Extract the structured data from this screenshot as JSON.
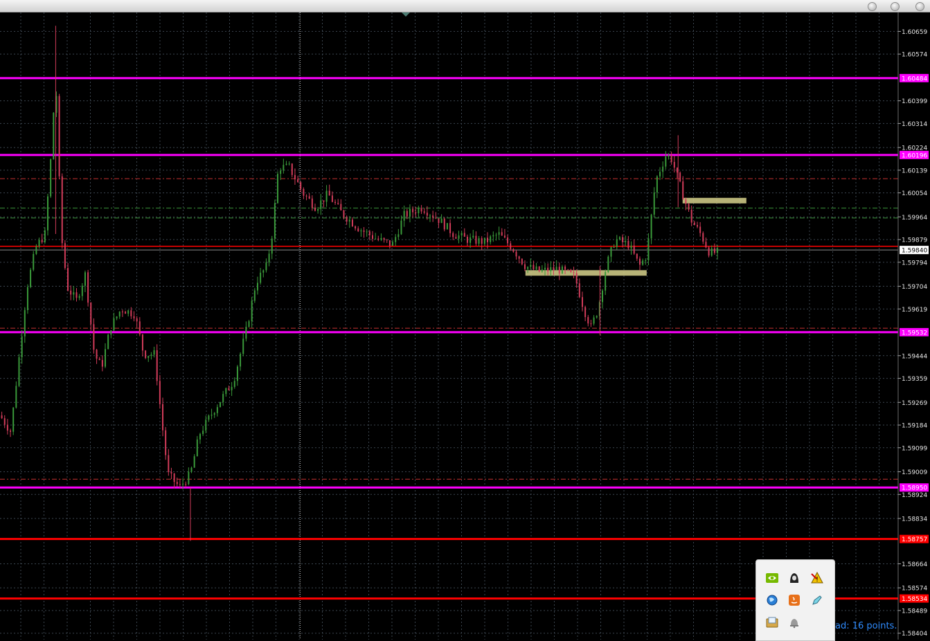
{
  "window": {
    "buttons": [
      "minimize",
      "zoom",
      "close"
    ]
  },
  "chart_data": {
    "type": "candlestick",
    "ylim": [
      1.5838,
      1.6073
    ],
    "grid": true,
    "background": "#000000",
    "colors": {
      "bull": "#3a9a3a",
      "bear": "#d23c5a",
      "grid": "#3c4650",
      "support_resistance": "#ff00ff",
      "strong_level": "#ff0000",
      "dotted_level": "#c83232",
      "green_level": "#3c963c",
      "zone": "#d7d28c"
    },
    "price_axis_ticks": [
      "1.60659",
      "1.60574",
      "1.60399",
      "1.60314",
      "1.60224",
      "1.60139",
      "1.60054",
      "1.59964",
      "1.59879",
      "1.59794",
      "1.59704",
      "1.59619",
      "1.59444",
      "1.59359",
      "1.59269",
      "1.59184",
      "1.59099",
      "1.59009",
      "1.58924",
      "1.58834",
      "1.58664",
      "1.58574",
      "1.58489",
      "1.58404"
    ],
    "price_axis_tick_values": [
      1.60659,
      1.60574,
      1.60399,
      1.60314,
      1.60224,
      1.60139,
      1.60054,
      1.59964,
      1.59879,
      1.59794,
      1.59704,
      1.59619,
      1.59444,
      1.59359,
      1.59269,
      1.59184,
      1.59099,
      1.59009,
      1.58924,
      1.58834,
      1.58664,
      1.58574,
      1.58489,
      1.58404
    ],
    "current_price": {
      "label": "1.59840",
      "value": 1.5984
    },
    "horizontal_levels": [
      {
        "label": "1.60484",
        "value": 1.60484,
        "style": "magenta-solid"
      },
      {
        "label": "1.60196",
        "value": 1.60196,
        "style": "magenta-solid"
      },
      {
        "label": "1.59532",
        "value": 1.59532,
        "style": "magenta-solid"
      },
      {
        "label": "1.58950",
        "value": 1.5895,
        "style": "magenta-solid"
      },
      {
        "label": "1.58757",
        "value": 1.58757,
        "style": "red-solid"
      },
      {
        "label": "1.58534",
        "value": 1.58534,
        "style": "red-solid"
      },
      {
        "label": "",
        "value": 1.59854,
        "style": "red-thin"
      },
      {
        "label": "",
        "value": 1.60107,
        "style": "red-dashdot"
      },
      {
        "label": "",
        "value": 1.59547,
        "style": "red-dashdot"
      },
      {
        "label": "",
        "value": 1.58981,
        "style": "red-dashdot"
      },
      {
        "label": "",
        "value": 1.59997,
        "style": "green-dashdot"
      },
      {
        "label": "",
        "value": 1.5996,
        "style": "green-dashdot"
      }
    ],
    "supply_demand_zones": [
      {
        "x_start": 0.76,
        "x_end": 0.831,
        "value": 1.60025
      },
      {
        "x_start": 0.585,
        "x_end": 0.72,
        "value": 1.59754
      }
    ],
    "cursor_vertical_line": 0.3225,
    "price_path": [
      {
        "t": 0.0,
        "v": 1.5922
      },
      {
        "t": 0.012,
        "v": 1.5916
      },
      {
        "t": 0.02,
        "v": 1.594
      },
      {
        "t": 0.03,
        "v": 1.597
      },
      {
        "t": 0.04,
        "v": 1.5985
      },
      {
        "t": 0.05,
        "v": 1.599
      },
      {
        "t": 0.057,
        "v": 1.602
      },
      {
        "t": 0.062,
        "v": 1.605
      },
      {
        "t": 0.068,
        "v": 1.599
      },
      {
        "t": 0.075,
        "v": 1.597
      },
      {
        "t": 0.085,
        "v": 1.5965
      },
      {
        "t": 0.095,
        "v": 1.5975
      },
      {
        "t": 0.105,
        "v": 1.5945
      },
      {
        "t": 0.113,
        "v": 1.594
      },
      {
        "t": 0.123,
        "v": 1.5955
      },
      {
        "t": 0.135,
        "v": 1.5962
      },
      {
        "t": 0.15,
        "v": 1.596
      },
      {
        "t": 0.16,
        "v": 1.5945
      },
      {
        "t": 0.172,
        "v": 1.5945
      },
      {
        "t": 0.18,
        "v": 1.592
      },
      {
        "t": 0.187,
        "v": 1.59
      },
      {
        "t": 0.2,
        "v": 1.5895
      },
      {
        "t": 0.212,
        "v": 1.59
      },
      {
        "t": 0.222,
        "v": 1.5915
      },
      {
        "t": 0.24,
        "v": 1.5925
      },
      {
        "t": 0.26,
        "v": 1.5935
      },
      {
        "t": 0.275,
        "v": 1.5955
      },
      {
        "t": 0.285,
        "v": 1.5972
      },
      {
        "t": 0.297,
        "v": 1.5978
      },
      {
        "t": 0.303,
        "v": 1.599
      },
      {
        "t": 0.31,
        "v": 1.6015
      },
      {
        "t": 0.322,
        "v": 1.6015
      },
      {
        "t": 0.338,
        "v": 1.6005
      },
      {
        "t": 0.352,
        "v": 1.6
      },
      {
        "t": 0.365,
        "v": 1.6005
      },
      {
        "t": 0.38,
        "v": 1.5998
      },
      {
        "t": 0.4,
        "v": 1.5992
      },
      {
        "t": 0.42,
        "v": 1.5988
      },
      {
        "t": 0.437,
        "v": 1.5986
      },
      {
        "t": 0.45,
        "v": 1.5997
      },
      {
        "t": 0.47,
        "v": 1.6
      },
      {
        "t": 0.49,
        "v": 1.5995
      },
      {
        "t": 0.505,
        "v": 1.599
      },
      {
        "t": 0.52,
        "v": 1.5988
      },
      {
        "t": 0.54,
        "v": 1.5987
      },
      {
        "t": 0.555,
        "v": 1.599
      },
      {
        "t": 0.57,
        "v": 1.5985
      },
      {
        "t": 0.585,
        "v": 1.5978
      },
      {
        "t": 0.6,
        "v": 1.5976
      },
      {
        "t": 0.62,
        "v": 1.5977
      },
      {
        "t": 0.64,
        "v": 1.5974
      },
      {
        "t": 0.65,
        "v": 1.5962
      },
      {
        "t": 0.658,
        "v": 1.5955
      },
      {
        "t": 0.666,
        "v": 1.5962
      },
      {
        "t": 0.675,
        "v": 1.5978
      },
      {
        "t": 0.685,
        "v": 1.5988
      },
      {
        "t": 0.7,
        "v": 1.5986
      },
      {
        "t": 0.712,
        "v": 1.5978
      },
      {
        "t": 0.72,
        "v": 1.5982
      },
      {
        "t": 0.73,
        "v": 1.601
      },
      {
        "t": 0.742,
        "v": 1.602
      },
      {
        "t": 0.748,
        "v": 1.6018
      },
      {
        "t": 0.76,
        "v": 1.6005
      },
      {
        "t": 0.77,
        "v": 1.5995
      },
      {
        "t": 0.78,
        "v": 1.599
      },
      {
        "t": 0.79,
        "v": 1.5983
      }
    ]
  },
  "tray": {
    "icons": [
      "nvidia-icon",
      "hooded-figure-icon",
      "warning-icon",
      "globe-icon",
      "java-icon",
      "pen-tool-icon",
      "folder-icon",
      "bell-icon"
    ]
  },
  "status": {
    "text": "ad: 16 points."
  }
}
